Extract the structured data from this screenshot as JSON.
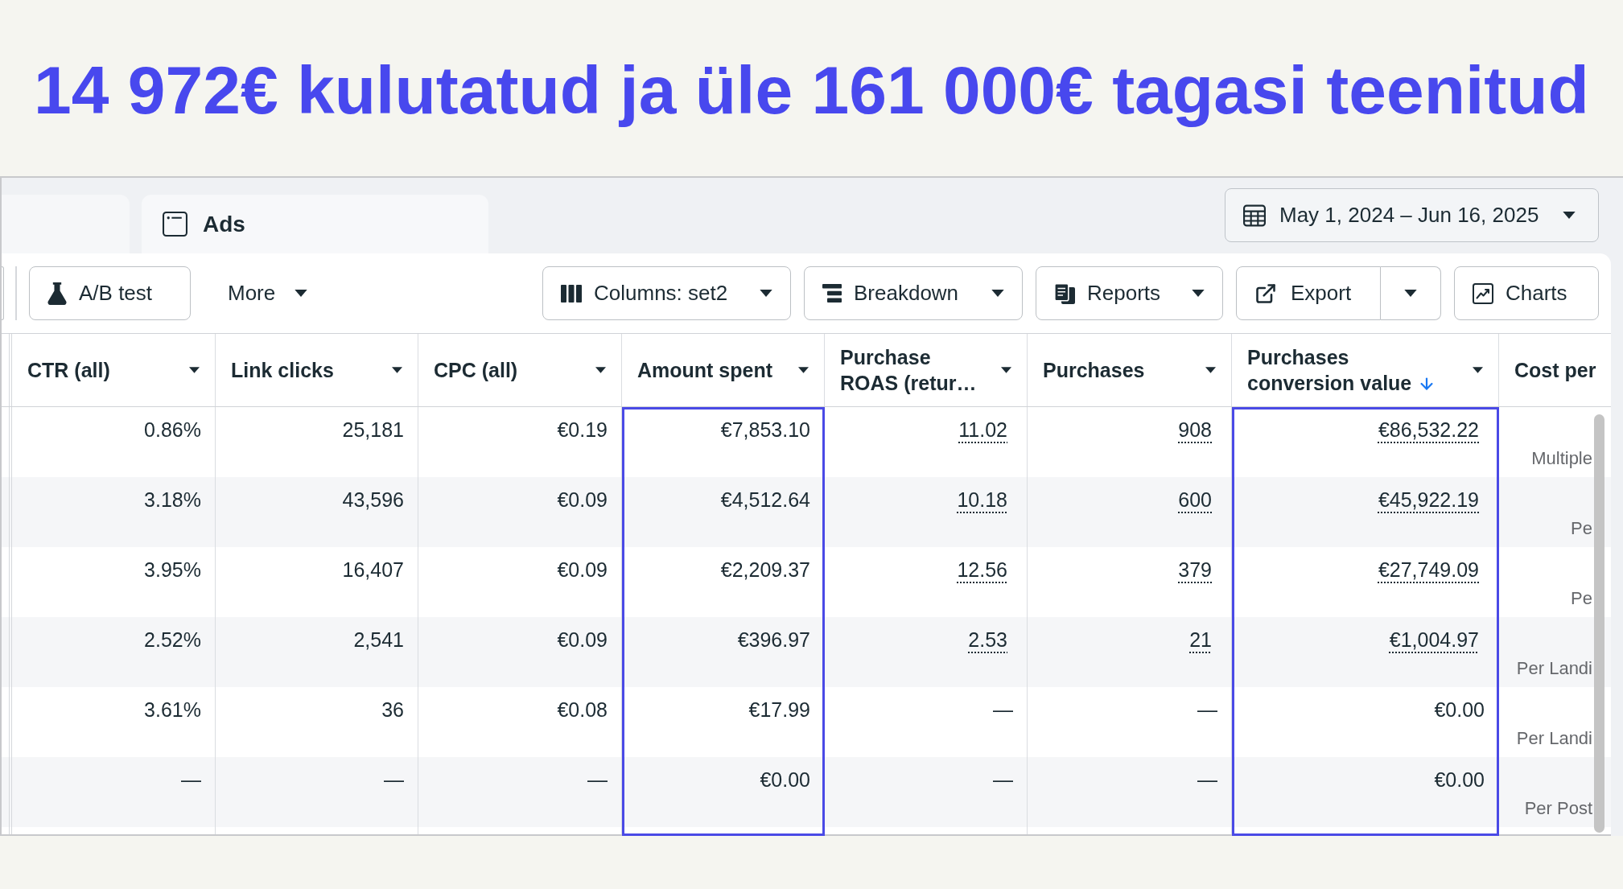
{
  "headline": "14 972€ kulutatud ja üle 161 000€ tagasi teenitud",
  "tabs": [
    {
      "label": "Ads",
      "selected": true
    }
  ],
  "date_range": {
    "label": "May 1, 2024 – Jun 16, 2025",
    "caret": true
  },
  "toolbar": [
    {
      "label": "A/B test",
      "kind": "outlined",
      "caret": false
    },
    {
      "label": "More",
      "kind": "plain",
      "caret": true
    },
    {
      "label": "Columns: set2",
      "kind": "outlined",
      "caret": true
    },
    {
      "label": "Breakdown",
      "kind": "outlined",
      "caret": true
    },
    {
      "label": "Reports",
      "kind": "outlined",
      "caret": true
    },
    {
      "label": "Export",
      "kind": "split",
      "caret": true
    },
    {
      "label": "Charts",
      "kind": "outlined",
      "caret": false
    }
  ],
  "table": {
    "columns": [
      {
        "label": "CTR (all)",
        "kind": "number",
        "menu": true,
        "sorted": false,
        "highlighted": false
      },
      {
        "label": "Link clicks",
        "kind": "number",
        "menu": true,
        "sorted": false,
        "highlighted": false
      },
      {
        "label": "CPC (all)",
        "kind": "number",
        "menu": true,
        "sorted": false,
        "highlighted": false
      },
      {
        "label": "Amount spent",
        "kind": "number",
        "menu": true,
        "sorted": false,
        "highlighted": true
      },
      {
        "label": "Purchase ROAS (retur…",
        "kind": "number",
        "menu": true,
        "sorted": false,
        "highlighted": false
      },
      {
        "label": "Purchases",
        "kind": "number",
        "menu": true,
        "sorted": false,
        "highlighted": false
      },
      {
        "label": "Purchases conversion value",
        "kind": "number",
        "menu": true,
        "sorted": true,
        "highlighted": true
      },
      {
        "label": "Cost per",
        "kind": "note",
        "menu": false,
        "sorted": false,
        "highlighted": false
      }
    ],
    "rows": [
      {
        "cells": [
          {
            "text": "0.86%",
            "link": false
          },
          {
            "text": "25,181",
            "link": false
          },
          {
            "text": "€0.19",
            "link": false
          },
          {
            "text": "€7,853.10",
            "link": false
          },
          {
            "text": "11.02",
            "link": true
          },
          {
            "text": "908",
            "link": true
          },
          {
            "text": "€86,532.22",
            "link": true
          },
          {
            "text": "Multiple",
            "link": false
          }
        ]
      },
      {
        "cells": [
          {
            "text": "3.18%",
            "link": false
          },
          {
            "text": "43,596",
            "link": false
          },
          {
            "text": "€0.09",
            "link": false
          },
          {
            "text": "€4,512.64",
            "link": false
          },
          {
            "text": "10.18",
            "link": true
          },
          {
            "text": "600",
            "link": true
          },
          {
            "text": "€45,922.19",
            "link": true
          },
          {
            "text": "Pe",
            "link": false
          }
        ]
      },
      {
        "cells": [
          {
            "text": "3.95%",
            "link": false
          },
          {
            "text": "16,407",
            "link": false
          },
          {
            "text": "€0.09",
            "link": false
          },
          {
            "text": "€2,209.37",
            "link": false
          },
          {
            "text": "12.56",
            "link": true
          },
          {
            "text": "379",
            "link": true
          },
          {
            "text": "€27,749.09",
            "link": true
          },
          {
            "text": "Pe",
            "link": false
          }
        ]
      },
      {
        "cells": [
          {
            "text": "2.52%",
            "link": false
          },
          {
            "text": "2,541",
            "link": false
          },
          {
            "text": "€0.09",
            "link": false
          },
          {
            "text": "€396.97",
            "link": false
          },
          {
            "text": "2.53",
            "link": true
          },
          {
            "text": "21",
            "link": true
          },
          {
            "text": "€1,004.97",
            "link": true
          },
          {
            "text": "Per Landi",
            "link": false
          }
        ]
      },
      {
        "cells": [
          {
            "text": "3.61%",
            "link": false
          },
          {
            "text": "36",
            "link": false
          },
          {
            "text": "€0.08",
            "link": false
          },
          {
            "text": "€17.99",
            "link": false
          },
          {
            "text": "—",
            "link": false
          },
          {
            "text": "—",
            "link": false
          },
          {
            "text": "€0.00",
            "link": false
          },
          {
            "text": "Per Landi",
            "link": false
          }
        ]
      },
      {
        "cells": [
          {
            "text": "—",
            "link": false
          },
          {
            "text": "—",
            "link": false
          },
          {
            "text": "—",
            "link": false
          },
          {
            "text": "€0.00",
            "link": false
          },
          {
            "text": "—",
            "link": false
          },
          {
            "text": "—",
            "link": false
          },
          {
            "text": "€0.00",
            "link": false
          },
          {
            "text": "Per Post",
            "link": false
          }
        ]
      }
    ]
  }
}
